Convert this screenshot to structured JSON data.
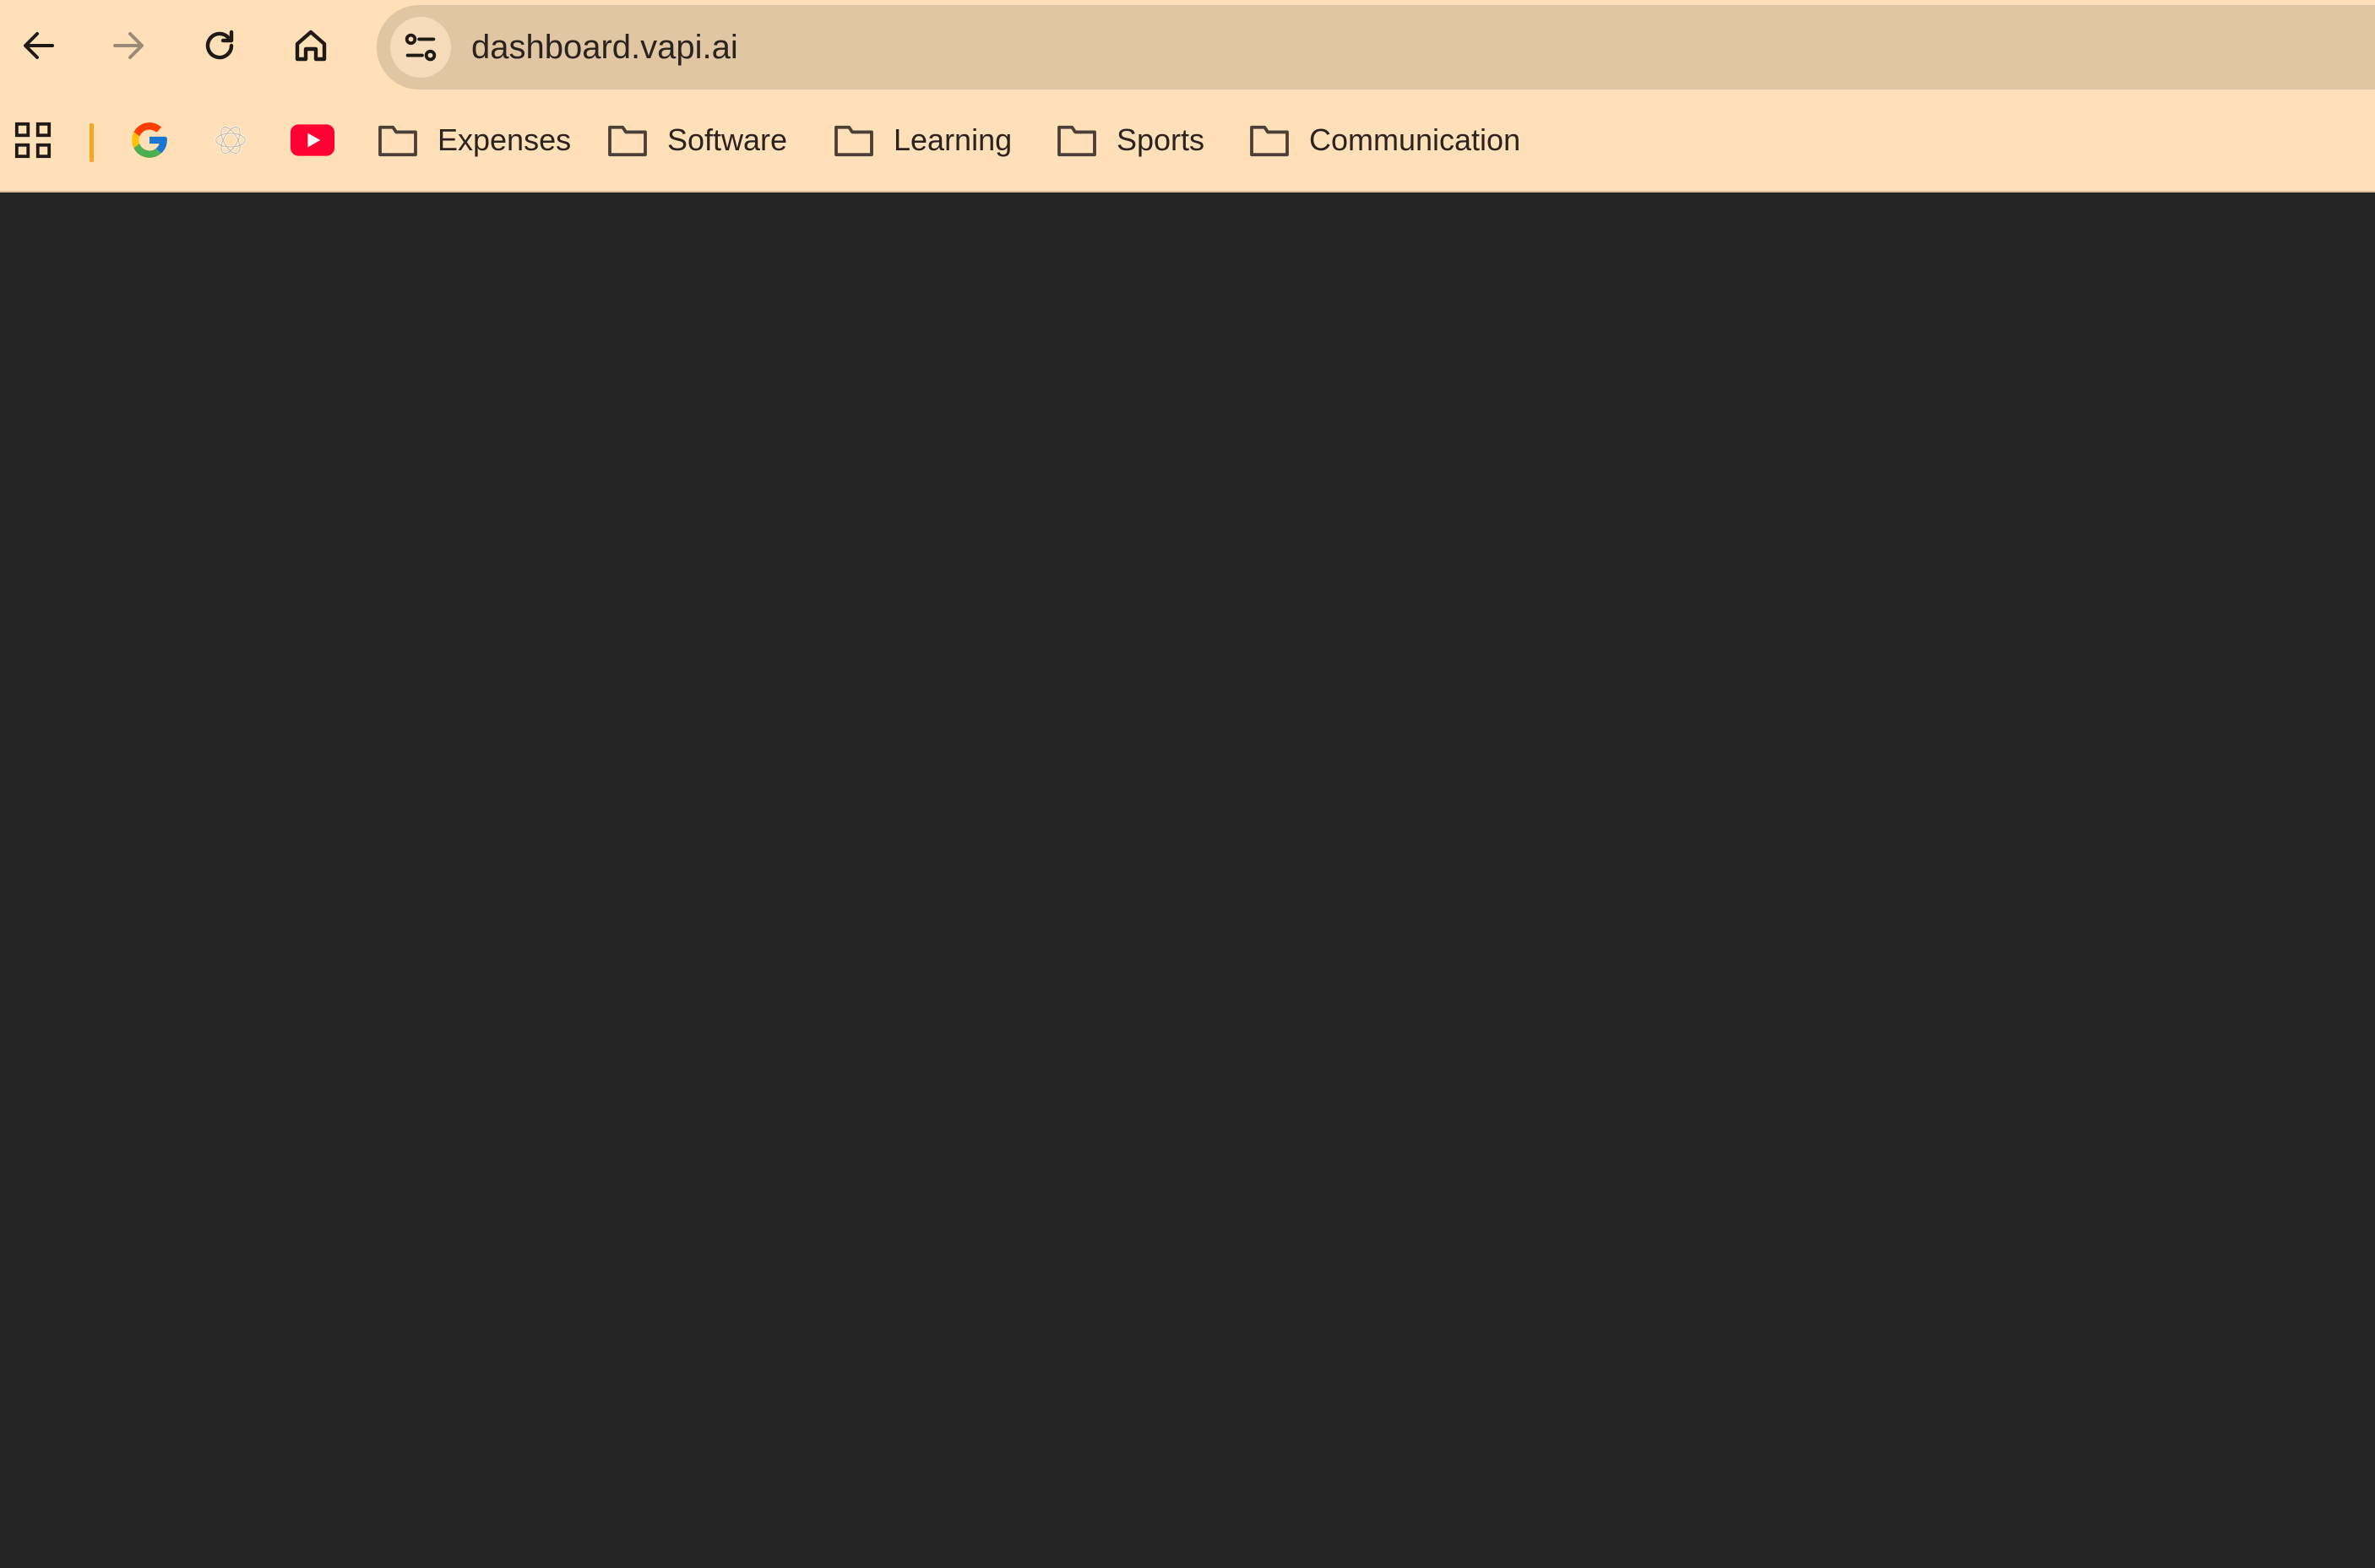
{
  "browser": {
    "url": "dashboard.vapi.ai",
    "nav": {
      "back": "arrow-left-icon",
      "forward": "arrow-right-icon",
      "reload": "reload-icon",
      "home": "home-icon"
    }
  },
  "bookmarks": {
    "items": [
      {
        "label": "Expenses",
        "icon": "folder-icon"
      },
      {
        "label": "Software",
        "icon": "folder-icon"
      },
      {
        "label": "Learning",
        "icon": "folder-icon"
      },
      {
        "label": "Sports",
        "icon": "folder-icon"
      },
      {
        "label": "Communication",
        "icon": "folder-icon"
      }
    ],
    "shortcuts": [
      "google-icon",
      "openai-icon",
      "youtube-icon"
    ]
  },
  "colors": {
    "chrome_bg": "#ffe0b8",
    "omnibox_bg": "#e1c6a4",
    "content_bg": "#242424",
    "separator": "#f5a623",
    "youtube_red": "#ff0033"
  }
}
